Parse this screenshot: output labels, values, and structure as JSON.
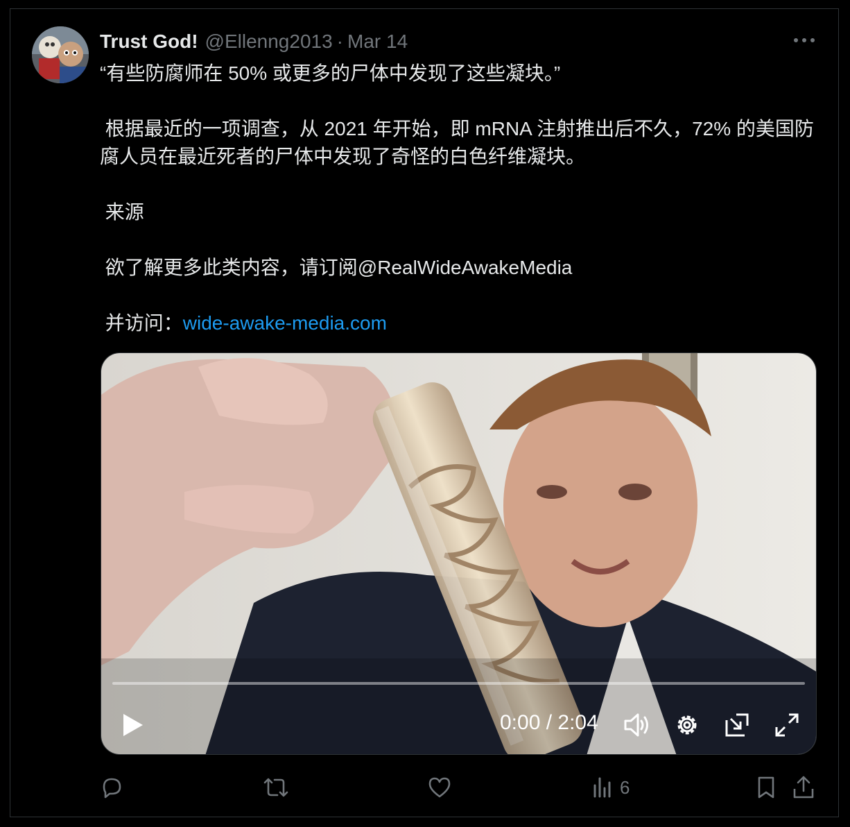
{
  "tweet": {
    "display_name": "Trust God!",
    "handle": "@Ellenng2013",
    "separator": "·",
    "date": "Mar 14",
    "paragraphs": [
      "“有些防腐师在 50% 或更多的尸体中发现了这些凝块。”",
      " 根据最近的一项调查，从 2021 年开始，即 mRNA 注射推出后不久，72% 的美国防腐人员在最近死者的尸体中发现了奇怪的白色纤维凝块。",
      " 来源",
      " 欲了解更多此类内容，请订阅@RealWideAwakeMedia"
    ],
    "visit_prefix": " 并访问：",
    "visit_link": "wide-awake-media.com"
  },
  "video": {
    "time_display": "0:00 / 2:04",
    "progress_fraction": 0.0
  },
  "actions": {
    "views_count": "6"
  },
  "icons": {
    "more": "more-icon",
    "play": "play-icon",
    "volume": "volume-icon",
    "settings": "gear-icon",
    "pip": "pip-icon",
    "fullscreen": "fullscreen-icon",
    "reply": "reply-icon",
    "retweet": "retweet-icon",
    "like": "heart-icon",
    "views": "views-icon",
    "bookmark": "bookmark-icon",
    "share": "share-icon"
  },
  "colors": {
    "background": "#000000",
    "text": "#e7e9ea",
    "muted": "#71767b",
    "link": "#1d9bf0"
  }
}
